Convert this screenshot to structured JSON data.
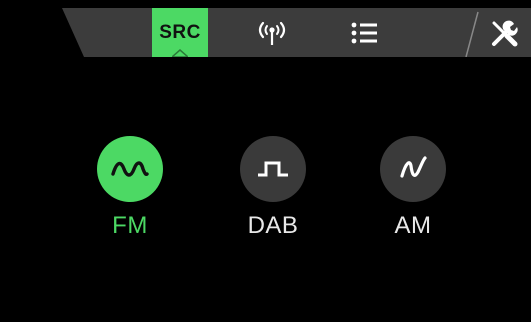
{
  "topbar": {
    "tabs": [
      {
        "id": "src",
        "label": "SRC",
        "active": true
      },
      {
        "id": "signal",
        "icon": "radio-signal-icon"
      },
      {
        "id": "list",
        "icon": "list-icon"
      },
      {
        "id": "settings",
        "icon": "tools-icon"
      }
    ]
  },
  "sources": [
    {
      "label": "FM",
      "icon": "fm-wave-icon",
      "active": true
    },
    {
      "label": "DAB",
      "icon": "dab-square-wave-icon",
      "active": false
    },
    {
      "label": "AM",
      "icon": "am-wave-icon",
      "active": false
    }
  ],
  "colors": {
    "accent": "#4cd964",
    "bar": "#3c3c3c",
    "inactive_circle": "#3a3a3a",
    "background": "#000000"
  }
}
